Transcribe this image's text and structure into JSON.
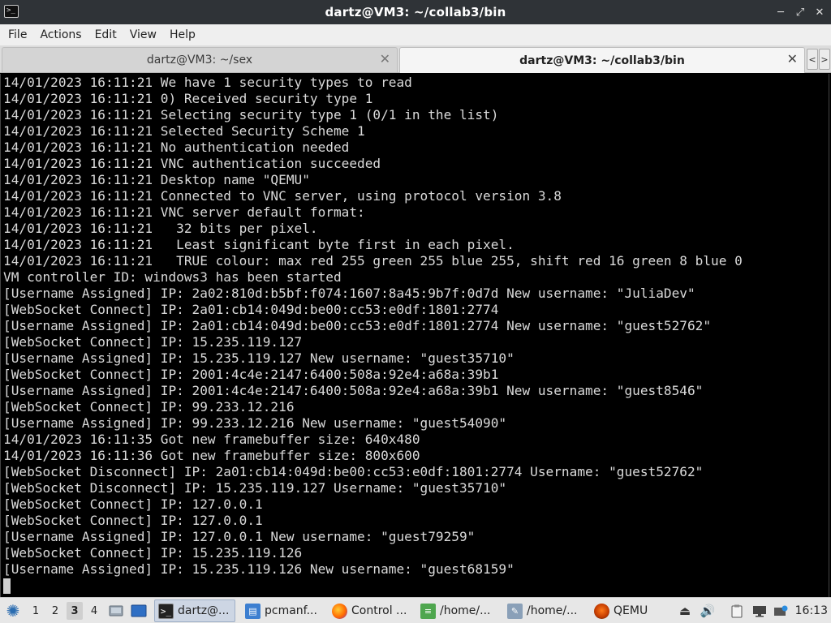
{
  "window": {
    "title": "dartz@VM3: ~/collab3/bin",
    "term_icon_glyph": ">_",
    "minimize_icon": "minimize-icon",
    "maximize_icon": "maximize-icon",
    "close_icon": "close-icon"
  },
  "menubar": {
    "items": [
      "File",
      "Actions",
      "Edit",
      "View",
      "Help"
    ]
  },
  "tabs": [
    {
      "label": "dartz@VM3: ~/sex",
      "active": false
    },
    {
      "label": "dartz@VM3: ~/collab3/bin",
      "active": true
    }
  ],
  "tab_scroll": {
    "left_glyph": "<",
    "right_glyph": ">"
  },
  "terminal": {
    "lines": [
      "14/01/2023 16:11:21 We have 1 security types to read",
      "14/01/2023 16:11:21 0) Received security type 1",
      "14/01/2023 16:11:21 Selecting security type 1 (0/1 in the list)",
      "14/01/2023 16:11:21 Selected Security Scheme 1",
      "14/01/2023 16:11:21 No authentication needed",
      "14/01/2023 16:11:21 VNC authentication succeeded",
      "14/01/2023 16:11:21 Desktop name \"QEMU\"",
      "14/01/2023 16:11:21 Connected to VNC server, using protocol version 3.8",
      "14/01/2023 16:11:21 VNC server default format:",
      "14/01/2023 16:11:21   32 bits per pixel.",
      "14/01/2023 16:11:21   Least significant byte first in each pixel.",
      "14/01/2023 16:11:21   TRUE colour: max red 255 green 255 blue 255, shift red 16 green 8 blue 0",
      "VM controller ID: windows3 has been started",
      "[Username Assigned] IP: 2a02:810d:b5bf:f074:1607:8a45:9b7f:0d7d New username: \"JuliaDev\"",
      "[WebSocket Connect] IP: 2a01:cb14:049d:be00:cc53:e0df:1801:2774",
      "[Username Assigned] IP: 2a01:cb14:049d:be00:cc53:e0df:1801:2774 New username: \"guest52762\"",
      "[WebSocket Connect] IP: 15.235.119.127",
      "[Username Assigned] IP: 15.235.119.127 New username: \"guest35710\"",
      "[WebSocket Connect] IP: 2001:4c4e:2147:6400:508a:92e4:a68a:39b1",
      "[Username Assigned] IP: 2001:4c4e:2147:6400:508a:92e4:a68a:39b1 New username: \"guest8546\"",
      "[WebSocket Connect] IP: 99.233.12.216",
      "[Username Assigned] IP: 99.233.12.216 New username: \"guest54090\"",
      "14/01/2023 16:11:35 Got new framebuffer size: 640x480",
      "14/01/2023 16:11:36 Got new framebuffer size: 800x600",
      "[WebSocket Disconnect] IP: 2a01:cb14:049d:be00:cc53:e0df:1801:2774 Username: \"guest52762\"",
      "[WebSocket Disconnect] IP: 15.235.119.127 Username: \"guest35710\"",
      "[WebSocket Connect] IP: 127.0.0.1",
      "[WebSocket Connect] IP: 127.0.0.1",
      "[Username Assigned] IP: 127.0.0.1 New username: \"guest79259\"",
      "[WebSocket Connect] IP: 15.235.119.126",
      "[Username Assigned] IP: 15.235.119.126 New username: \"guest68159\""
    ]
  },
  "taskbar": {
    "start_icon": "start-menu-icon",
    "workspaces": [
      "1",
      "2",
      "3",
      "4"
    ],
    "active_workspace": "3",
    "quick_launch": [
      "show-desktop-icon",
      "window-switcher-icon"
    ],
    "tasks": [
      {
        "label": "dartz@...",
        "icon": "terminal-icon",
        "active": true
      },
      {
        "label": "pcmanf...",
        "icon": "folder-icon",
        "active": false
      },
      {
        "label": "Control ...",
        "icon": "firefox-icon",
        "active": false
      },
      {
        "label": "/home/...",
        "icon": "text-editor-icon",
        "active": false
      },
      {
        "label": "/home/...",
        "icon": "image-viewer-icon",
        "active": false
      },
      {
        "label": "QEMU",
        "icon": "qemu-icon",
        "active": false
      }
    ],
    "tray": [
      "eject-icon",
      "volume-icon",
      "clipboard-icon",
      "display-icon",
      "network-icon"
    ],
    "clock": "16:13"
  },
  "colors": {
    "titlebar": "#2f3337",
    "terminal_bg": "#000000",
    "terminal_fg": "#dadada",
    "taskbar": "#e7e7e7",
    "active_task": "#cdd6e4"
  }
}
